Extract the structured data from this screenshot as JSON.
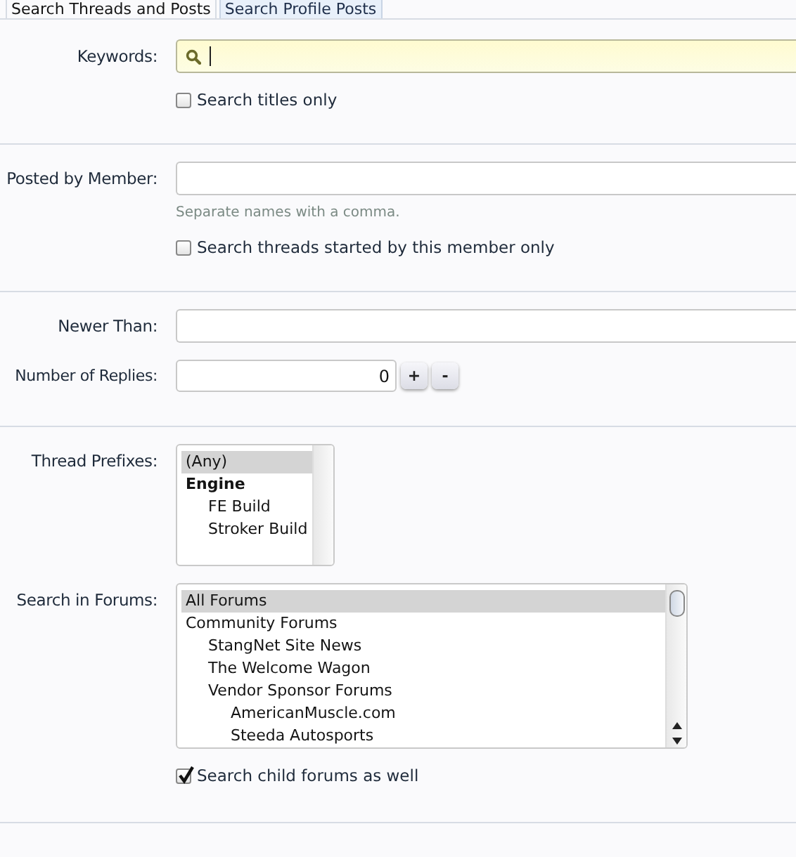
{
  "tabs": [
    {
      "label": "Search Threads and Posts",
      "selected": true
    },
    {
      "label": "Search Profile Posts",
      "selected": false
    }
  ],
  "sections": [
    {
      "rows": [
        {
          "kind": "search",
          "label": "Keywords:",
          "focused": true
        },
        {
          "kind": "checkbox",
          "text": "Search titles only",
          "checked": false
        }
      ]
    },
    {
      "rows": [
        {
          "kind": "text",
          "label": "Posted by Member:"
        },
        {
          "kind": "hint",
          "text": "Separate names with a comma."
        },
        {
          "kind": "checkbox",
          "text": "Search threads started by this member only",
          "checked": false
        }
      ]
    },
    {
      "rows": [
        {
          "kind": "text",
          "label": "Newer Than:"
        },
        {
          "kind": "spinner",
          "label": "Number of Replies:",
          "value": "0",
          "buttons": [
            "+",
            "-"
          ]
        }
      ]
    },
    {
      "rows": [
        {
          "kind": "listbox",
          "label": "Thread Prefixes:",
          "items": [
            {
              "kind": "option",
              "text": "(Any)",
              "selected": true
            },
            {
              "kind": "group",
              "text": "Engine",
              "selected": false,
              "children": [
                {
                  "kind": "option",
                  "text": "FE Build",
                  "selected": false
                },
                {
                  "kind": "option",
                  "text": "Stroker Build",
                  "selected": false
                }
              ]
            }
          ]
        },
        {
          "kind": "listbox",
          "label": "Search in Forums:",
          "items": [
            {
              "kind": "option",
              "text": "All Forums",
              "selected": true
            },
            {
              "kind": "option",
              "text": "Community Forums",
              "selected": false,
              "children": [
                {
                  "kind": "option",
                  "text": "StangNet Site News",
                  "selected": false
                },
                {
                  "kind": "option",
                  "text": "The Welcome Wagon",
                  "selected": false
                },
                {
                  "kind": "option",
                  "text": "Vendor Sponsor Forums",
                  "selected": false,
                  "children": [
                    {
                      "kind": "option",
                      "text": "AmericanMuscle.com",
                      "selected": false
                    },
                    {
                      "kind": "option",
                      "text": "Steeda Autosports",
                      "selected": false
                    }
                  ]
                }
              ]
            }
          ]
        },
        {
          "kind": "checkbox",
          "text": "Search child forums as well",
          "checked": true
        }
      ]
    }
  ]
}
